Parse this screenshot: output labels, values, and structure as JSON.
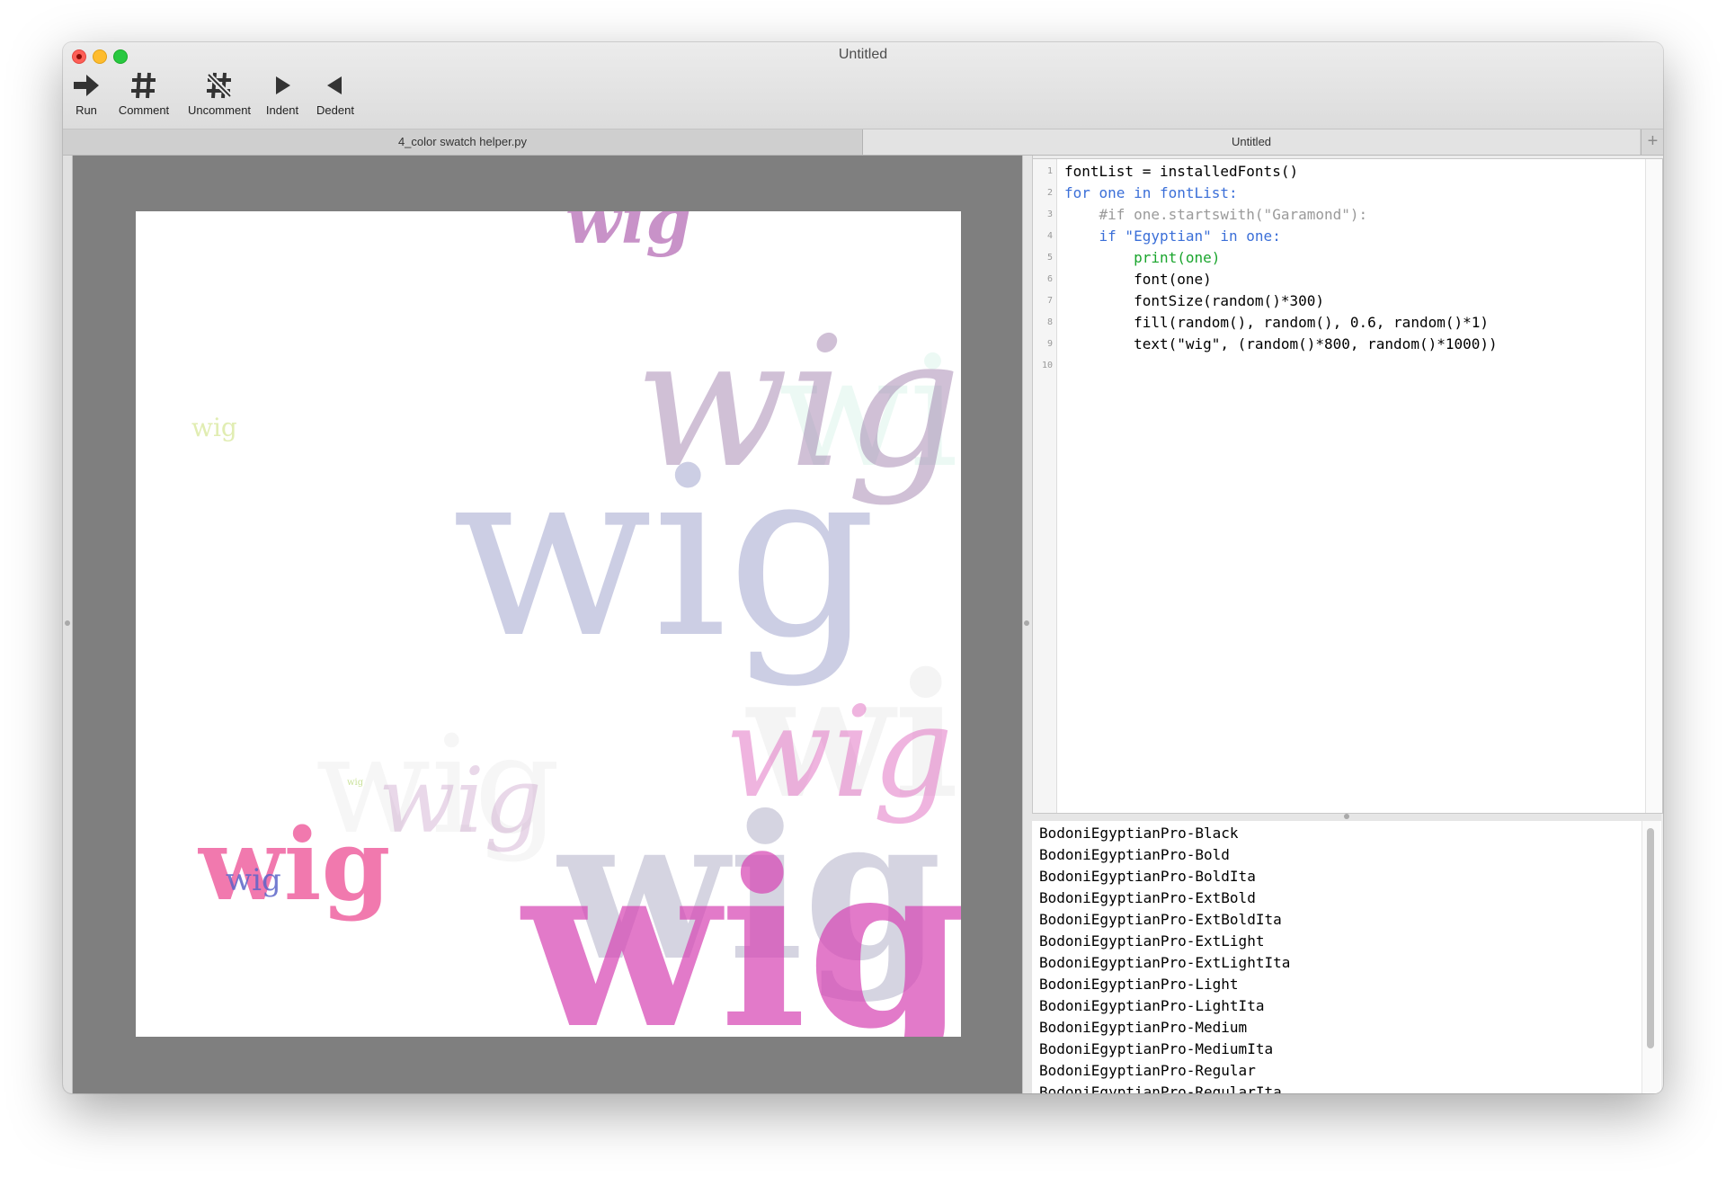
{
  "window": {
    "title": "Untitled"
  },
  "toolbar": [
    {
      "label": "Run",
      "icon": "run-arrow-icon"
    },
    {
      "label": "Comment",
      "icon": "hash-icon"
    },
    {
      "label": "Uncomment",
      "icon": "hash-struck-icon"
    },
    {
      "label": "Indent",
      "icon": "indent-triangle-icon"
    },
    {
      "label": "Dedent",
      "icon": "dedent-triangle-icon"
    }
  ],
  "tabs": [
    {
      "label": "4_color swatch helper.py"
    },
    {
      "label": "Untitled"
    }
  ],
  "tab_add_label": "+",
  "canvas": {
    "word": "wig"
  },
  "editor": {
    "line_numbers": [
      "1",
      "2",
      "3",
      "4",
      "5",
      "6",
      "7",
      "8",
      "9",
      "10"
    ],
    "lines": [
      "fontList = installedFonts()",
      "for one in fontList:",
      "    #if one.startswith(\"Garamond\"):",
      "    if \"Egyptian\" in one:",
      "        print(one)",
      "        font(one)",
      "        fontSize(random()*300)",
      "        fill(random(), random(), 0.6, random()*1)",
      "        text(\"wig\", (random()*800, random()*1000))",
      ""
    ]
  },
  "output": {
    "lines": [
      "BodoniEgyptianPro-Black",
      "BodoniEgyptianPro-Bold",
      "BodoniEgyptianPro-BoldIta",
      "BodoniEgyptianPro-ExtBold",
      "BodoniEgyptianPro-ExtBoldIta",
      "BodoniEgyptianPro-ExtLight",
      "BodoniEgyptianPro-ExtLightIta",
      "BodoniEgyptianPro-Light",
      "BodoniEgyptianPro-LightIta",
      "BodoniEgyptianPro-Medium",
      "BodoniEgyptianPro-MediumIta",
      "BodoniEgyptianPro-Regular",
      "BodoniEgyptianPro-RegularIta"
    ]
  },
  "colors": {
    "canvas_bg": "#7f7f7f",
    "keyword": "#3b6fd8",
    "string": "#d61fb8",
    "number": "#d63a3a",
    "builtin": "#1aa52d",
    "comment": "#9a9a9a"
  }
}
